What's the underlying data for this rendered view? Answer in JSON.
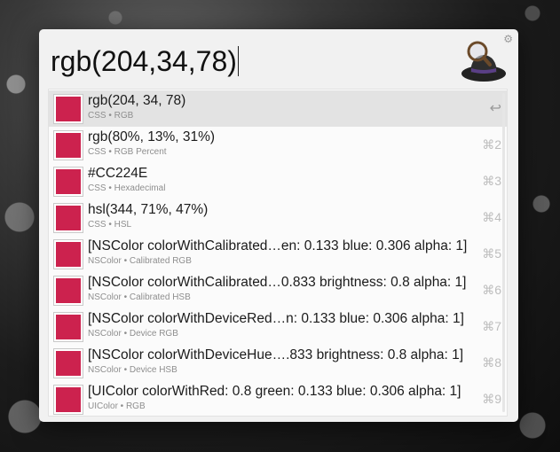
{
  "search": {
    "query": "rgb(204,34,78)"
  },
  "swatch_color": "#CC224E",
  "results": [
    {
      "title": "rgb(204, 34, 78)",
      "subtitle": "CSS • RGB",
      "shortcut": "↩"
    },
    {
      "title": "rgb(80%, 13%, 31%)",
      "subtitle": "CSS • RGB Percent",
      "shortcut": "⌘2"
    },
    {
      "title": "#CC224E",
      "subtitle": "CSS • Hexadecimal",
      "shortcut": "⌘3"
    },
    {
      "title": "hsl(344, 71%, 47%)",
      "subtitle": "CSS • HSL",
      "shortcut": "⌘4"
    },
    {
      "title": "[NSColor colorWithCalibrated…en: 0.133 blue: 0.306 alpha: 1]",
      "subtitle": "NSColor • Calibrated RGB",
      "shortcut": "⌘5"
    },
    {
      "title": "[NSColor colorWithCalibrated…0.833 brightness: 0.8 alpha: 1]",
      "subtitle": "NSColor • Calibrated HSB",
      "shortcut": "⌘6"
    },
    {
      "title": "[NSColor colorWithDeviceRed…n: 0.133 blue: 0.306 alpha: 1]",
      "subtitle": "NSColor • Device RGB",
      "shortcut": "⌘7"
    },
    {
      "title": "[NSColor colorWithDeviceHue….833 brightness: 0.8 alpha: 1]",
      "subtitle": "NSColor • Device HSB",
      "shortcut": "⌘8"
    },
    {
      "title": "[UIColor colorWithRed: 0.8 green: 0.133 blue: 0.306 alpha: 1]",
      "subtitle": "UIColor • RGB",
      "shortcut": "⌘9"
    }
  ]
}
